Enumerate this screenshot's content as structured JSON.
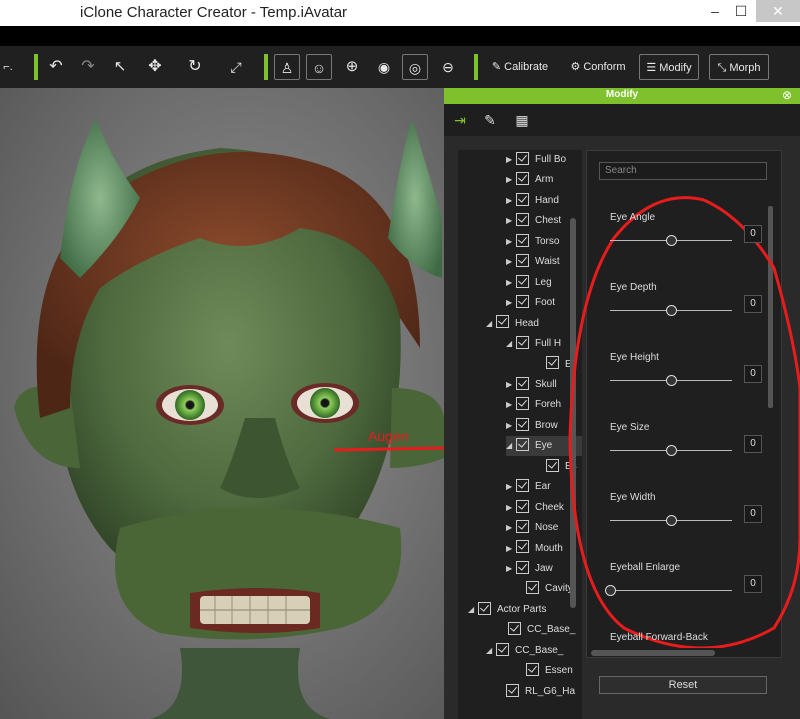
{
  "window": {
    "title": "iClone Character Creator - Temp.iAvatar",
    "minimize": "–",
    "maximize": "☐",
    "close": "✕"
  },
  "toolbar": {
    "calibrate": "Calibrate",
    "conform": "Conform",
    "modify": "Modify",
    "morph": "Morph"
  },
  "viewport": {
    "annotation": "Augen"
  },
  "panel": {
    "title": "Modify",
    "close": "⊗"
  },
  "tree": [
    {
      "label": "Full Bo",
      "arrow": "▶",
      "checked": true
    },
    {
      "label": "Arm",
      "arrow": "▶",
      "checked": true
    },
    {
      "label": "Hand",
      "arrow": "▶",
      "checked": true
    },
    {
      "label": "Chest",
      "arrow": "▶",
      "checked": true
    },
    {
      "label": "Torso",
      "arrow": "▶",
      "checked": true
    },
    {
      "label": "Waist",
      "arrow": "▶",
      "checked": true
    },
    {
      "label": "Leg",
      "arrow": "▶",
      "checked": true
    },
    {
      "label": "Foot",
      "arrow": "▶",
      "checked": true
    },
    {
      "label": "Head",
      "arrow": "◢",
      "checked": true
    },
    {
      "label": "Full H",
      "arrow": "◢",
      "checked": true
    },
    {
      "label": "Es",
      "arrow": "",
      "checked": true
    },
    {
      "label": "Skull",
      "arrow": "▶",
      "checked": true
    },
    {
      "label": "Foreh",
      "arrow": "▶",
      "checked": true
    },
    {
      "label": "Brow",
      "arrow": "▶",
      "checked": true
    },
    {
      "label": "Eye",
      "arrow": "◢",
      "checked": true
    },
    {
      "label": "Es",
      "arrow": "",
      "checked": true
    },
    {
      "label": "Ear",
      "arrow": "▶",
      "checked": true
    },
    {
      "label": "Cheek",
      "arrow": "▶",
      "checked": true
    },
    {
      "label": "Nose",
      "arrow": "▶",
      "checked": true
    },
    {
      "label": "Mouth",
      "arrow": "▶",
      "checked": true
    },
    {
      "label": "Jaw",
      "arrow": "▶",
      "checked": true
    },
    {
      "label": "Cavity",
      "arrow": "",
      "checked": true
    },
    {
      "label": "Actor Parts",
      "arrow": "◢",
      "checked": true
    },
    {
      "label": "CC_Base_",
      "arrow": "",
      "checked": true
    },
    {
      "label": "CC_Base_",
      "arrow": "◢",
      "checked": true
    },
    {
      "label": "Essen",
      "arrow": "",
      "checked": true
    },
    {
      "label": "RL_G6_Ha",
      "arrow": "",
      "checked": true
    }
  ],
  "search": {
    "placeholder": "Search"
  },
  "sliders": [
    {
      "label": "Eye Angle",
      "value": "0",
      "level": 0.5
    },
    {
      "label": "Eye Depth",
      "value": "0",
      "level": 0.5
    },
    {
      "label": "Eye Height",
      "value": "0",
      "level": 0.5
    },
    {
      "label": "Eye Size",
      "value": "0",
      "level": 0.5
    },
    {
      "label": "Eye Width",
      "value": "0",
      "level": 0.5
    },
    {
      "label": "Eyeball Enlarge",
      "value": "0",
      "level": 0.0
    },
    {
      "label": "Eyeball Forward-Back",
      "value": "",
      "level": null
    }
  ],
  "reset_label": "Reset",
  "colors": {
    "accent": "#7ec12c",
    "annotation": "#e81c1c"
  }
}
